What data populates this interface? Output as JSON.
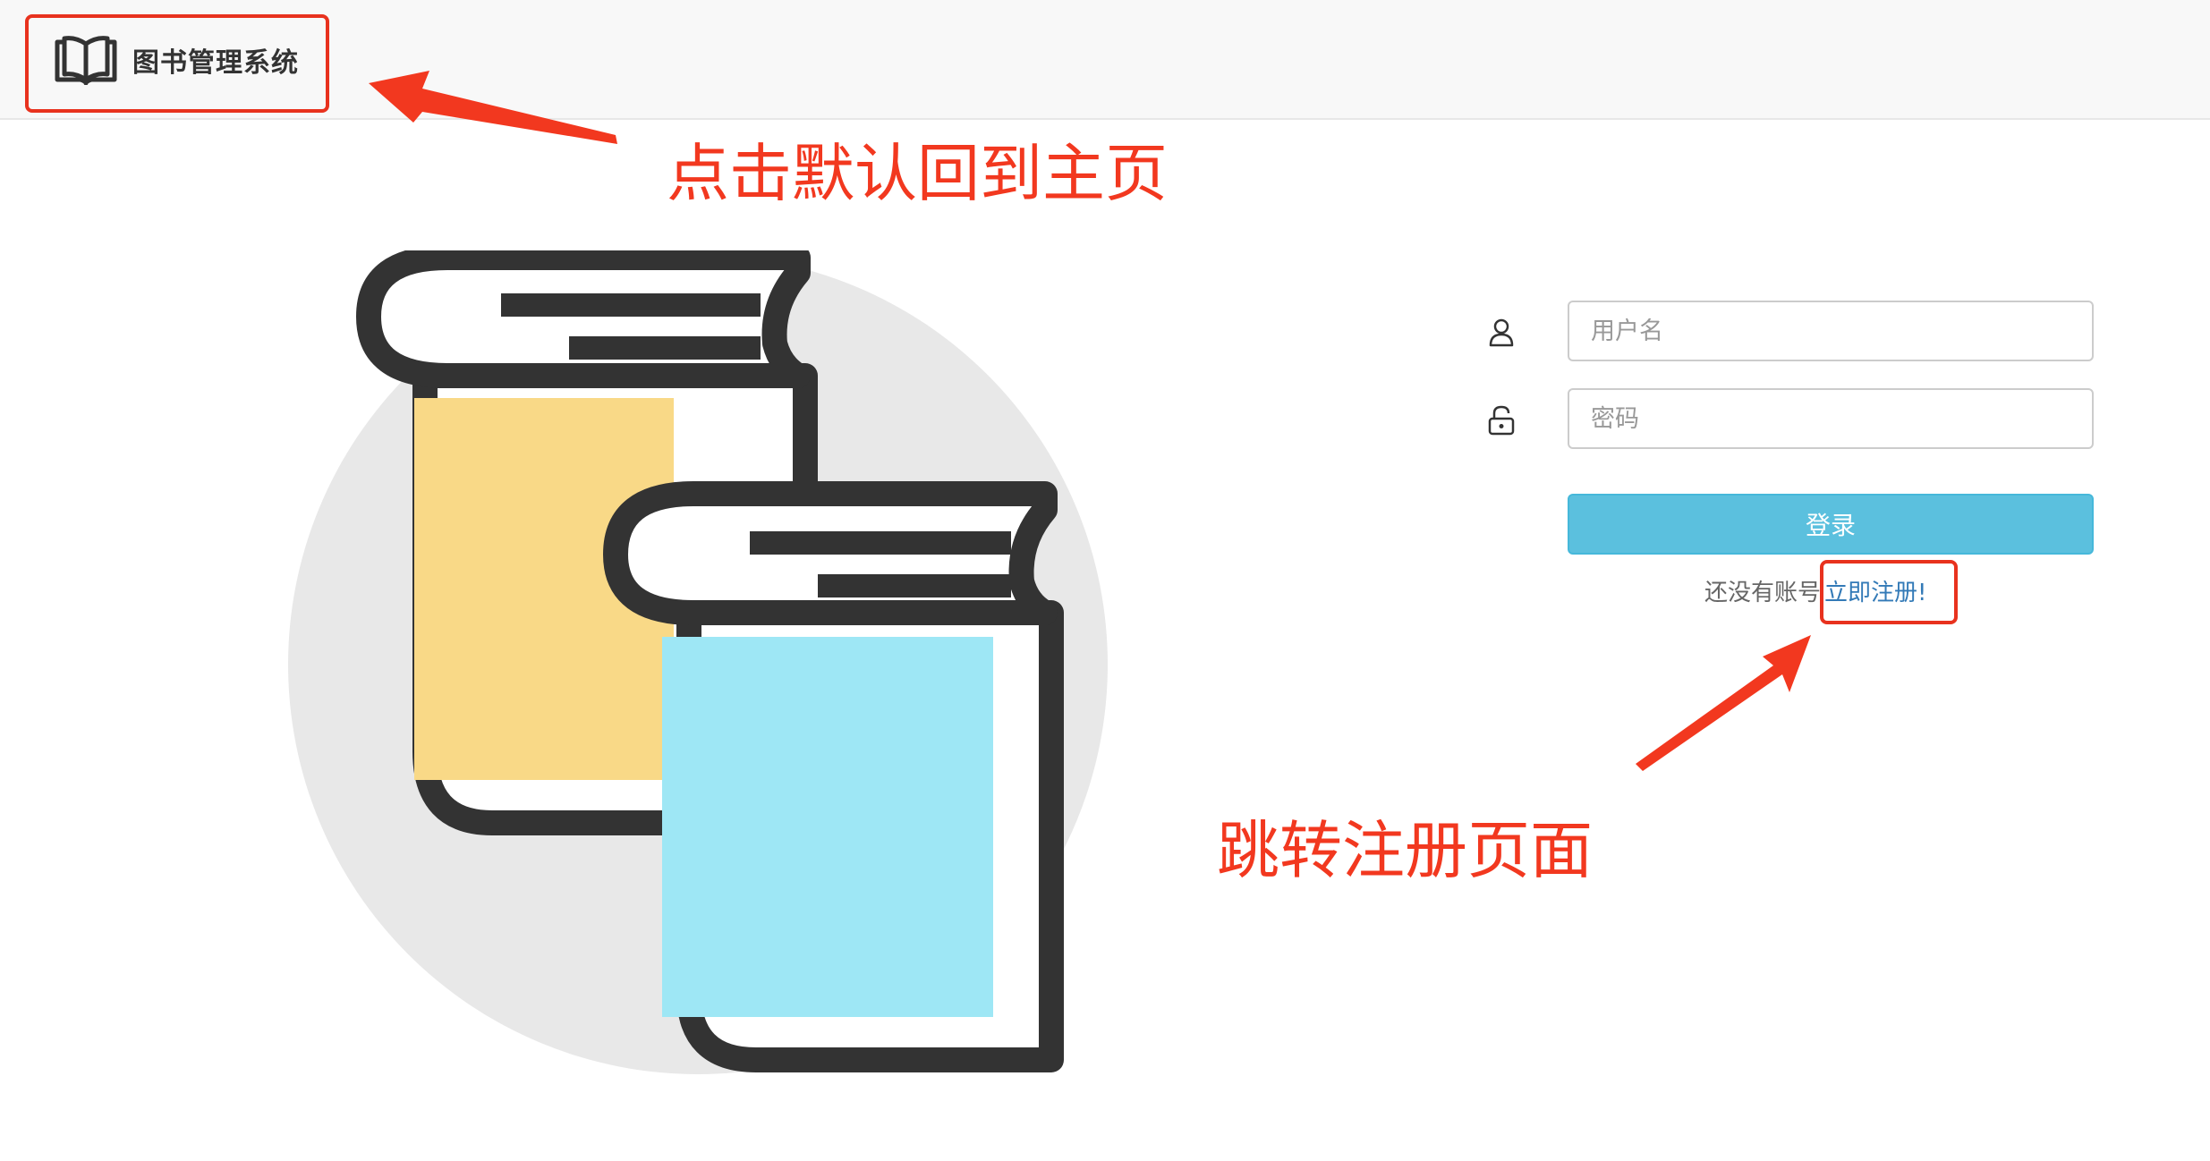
{
  "navbar": {
    "brand_title": "图书管理系统",
    "brand_icon": "open-book-icon"
  },
  "login": {
    "username_placeholder": "用户名",
    "password_placeholder": "密码",
    "username_icon": "user-icon",
    "password_icon": "lock-icon",
    "submit_label": "登录",
    "register_prompt": "还没有账号",
    "register_link": "立即注册!"
  },
  "illustration": {
    "icon": "two-books-illustration"
  },
  "annotations": {
    "brand_note": "点击默认回到主页",
    "register_note": "跳转注册页面",
    "color": "#f2381f"
  },
  "colors": {
    "navbar_bg": "#f8f8f8",
    "login_button": "#5bc0de",
    "link": "#337ab7",
    "book_yellow": "#f9d987",
    "book_blue": "#9ee7f5",
    "book_outline": "#333333",
    "circle_bg": "#e8e8e8"
  }
}
